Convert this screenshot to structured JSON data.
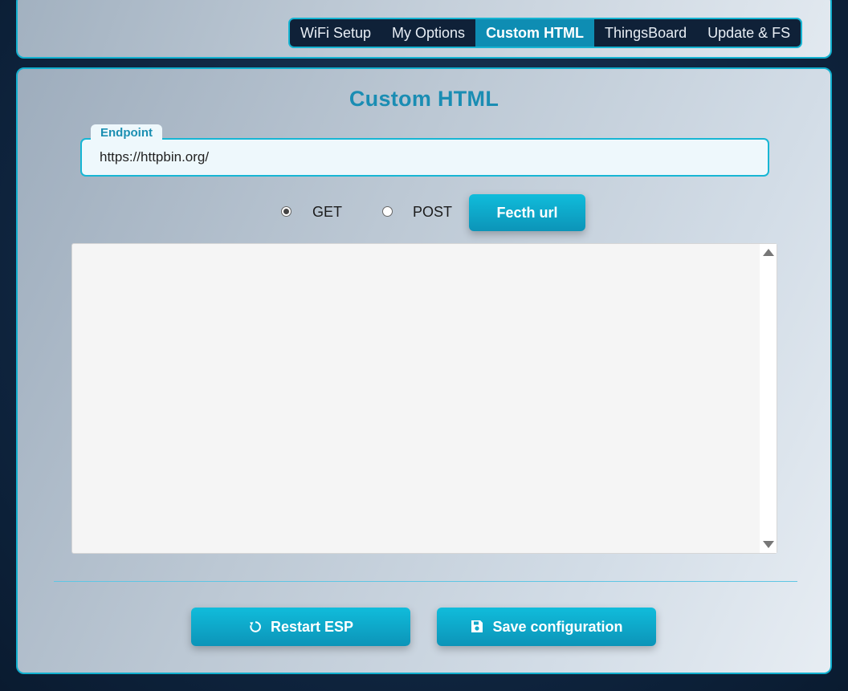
{
  "nav": {
    "tabs": [
      {
        "label": "WiFi Setup",
        "active": false
      },
      {
        "label": "My Options",
        "active": false
      },
      {
        "label": "Custom HTML",
        "active": true
      },
      {
        "label": "ThingsBoard",
        "active": false
      },
      {
        "label": "Update & FS",
        "active": false
      }
    ]
  },
  "panel": {
    "title": "Custom HTML",
    "endpoint": {
      "label": "Endpoint",
      "value": "https://httpbin.org/"
    },
    "methods": {
      "get_label": "GET",
      "post_label": "POST",
      "selected": "GET"
    },
    "fetch_label": "Fecth url",
    "response_text": "",
    "restart_label": "Restart ESP",
    "save_label": "Save configuration"
  },
  "colors": {
    "accent": "#0e8db3",
    "border": "#12b0cf",
    "title": "#1a8db3"
  },
  "icons": {
    "restart": "restart-icon",
    "save": "save-icon",
    "scroll_up": "arrow-up-icon",
    "scroll_down": "arrow-down-icon"
  }
}
